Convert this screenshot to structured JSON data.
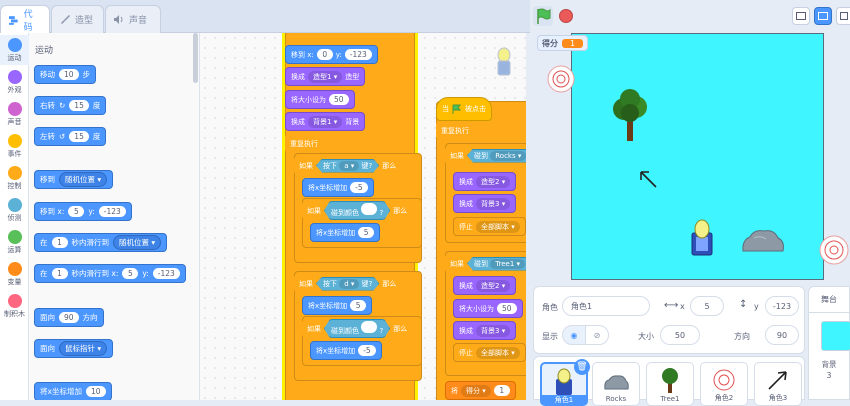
{
  "tabs": [
    {
      "label": "代码",
      "icon": "code-icon",
      "active": true
    },
    {
      "label": "造型",
      "icon": "brush-icon",
      "active": false
    },
    {
      "label": "声音",
      "icon": "speaker-icon",
      "active": false
    }
  ],
  "categories": [
    {
      "label": "运动",
      "color": "#4c97ff"
    },
    {
      "label": "外观",
      "color": "#9966ff"
    },
    {
      "label": "声音",
      "color": "#cf63cf"
    },
    {
      "label": "事件",
      "color": "#ffbf00"
    },
    {
      "label": "控制",
      "color": "#ffab19"
    },
    {
      "label": "侦测",
      "color": "#5cb1d6"
    },
    {
      "label": "运算",
      "color": "#59c059"
    },
    {
      "label": "变量",
      "color": "#ff8c1a"
    },
    {
      "label": "制积木",
      "color": "#ff6680"
    }
  ],
  "palette": {
    "title": "运动",
    "move": {
      "a": "移动",
      "n": "10",
      "b": "步"
    },
    "turn_right": {
      "a": "右转",
      "n": "15",
      "b": "度"
    },
    "turn_left": {
      "a": "左转",
      "n": "15",
      "b": "度"
    },
    "goto": {
      "a": "移到",
      "dd": "随机位置"
    },
    "goto_xy": {
      "a": "移到 x:",
      "x": "5",
      "yl": "y:",
      "y": "-123"
    },
    "glide_to": {
      "a": "在",
      "n": "1",
      "b": "秒内滑行到",
      "dd": "随机位置"
    },
    "glide_xy": {
      "a": "在",
      "n": "1",
      "b": "秒内滑行到 x:",
      "x": "5",
      "yl": "y:",
      "y": "-123"
    },
    "point_dir": {
      "a": "面向",
      "n": "90",
      "b": "方向"
    },
    "point_towards": {
      "a": "面向",
      "dd": "鼠标指针"
    },
    "change_x": {
      "a": "将x坐标增加",
      "n": "10"
    }
  },
  "script1": {
    "goto_xy": {
      "a": "移到 x:",
      "x": "0",
      "yl": "y:",
      "y": "-123"
    },
    "costume": {
      "a": "换成",
      "dd": "造型1",
      "b": "造型"
    },
    "size": {
      "a": "将大小设为",
      "n": "50"
    },
    "backdrop": {
      "a": "换成",
      "dd": "背景1",
      "b": "背景"
    },
    "forever": "重复执行",
    "if1": {
      "a": "如果",
      "b": "按下",
      "dd": "a",
      "c": "键?",
      "d": "那么"
    },
    "changex1": {
      "a": "将x坐标增加",
      "n": "-5"
    },
    "if2": {
      "a": "如果",
      "b": "碰到颜色",
      "c": "?",
      "d": "那么"
    },
    "changex2": {
      "a": "将x坐标增加",
      "n": "5"
    },
    "if3": {
      "a": "如果",
      "b": "按下",
      "dd": "d",
      "c": "键?",
      "d": "那么"
    },
    "changex3": {
      "a": "将x坐标增加",
      "n": "5"
    },
    "if4": {
      "a": "如果",
      "b": "碰到颜色",
      "c": "?",
      "d": "那么"
    },
    "changex4": {
      "a": "将x坐标增加",
      "n": "-5"
    }
  },
  "script2": {
    "hat": {
      "a": "当",
      "b": "被点击"
    },
    "forever": "重复执行",
    "if1": {
      "a": "如果",
      "b": "碰到",
      "dd": "Rocks"
    },
    "costume2": {
      "a": "换成",
      "dd": "造型2"
    },
    "backdrop3": {
      "a": "换成",
      "dd": "背景3"
    },
    "stop1": {
      "a": "停止",
      "dd": "全部脚本"
    },
    "if2": {
      "a": "如果",
      "b": "碰到",
      "dd": "Tree1"
    },
    "costume2b": {
      "a": "换成",
      "dd": "造型2"
    },
    "size": {
      "a": "将大小设为",
      "n": "50"
    },
    "backdrop3b": {
      "a": "换成",
      "dd": "背景3"
    },
    "stop2": {
      "a": "停止",
      "dd": "全部脚本"
    },
    "change_var": {
      "a": "将",
      "dd": "得分",
      "n": "1"
    }
  },
  "stage": {
    "monitor_label": "得分",
    "monitor_value": "1"
  },
  "sprite_info": {
    "sprite_label": "角色",
    "sprite_name": "角色1",
    "x_label": "x",
    "x": "5",
    "y_label": "y",
    "y": "-123",
    "show_label": "显示",
    "size_label": "大小",
    "size": "50",
    "direction_label": "方向",
    "direction": "90"
  },
  "sprites": [
    {
      "name": "角色1",
      "selected": true
    },
    {
      "name": "Rocks",
      "selected": false
    },
    {
      "name": "Tree1",
      "selected": false
    },
    {
      "name": "角色2",
      "selected": false
    },
    {
      "name": "角色3",
      "selected": false
    }
  ],
  "stage_panel": {
    "title": "舞台",
    "backdrops_label": "背景",
    "backdrops_count": "3"
  }
}
